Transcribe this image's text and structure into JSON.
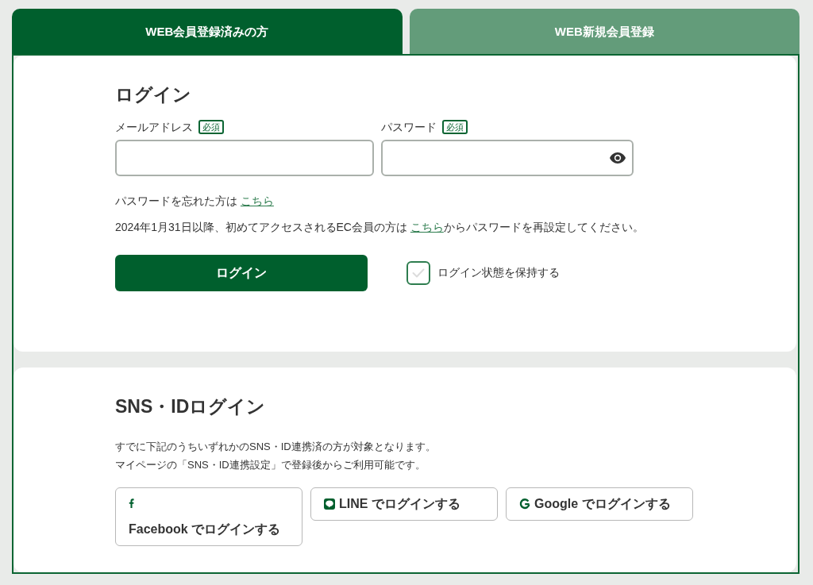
{
  "tabs": [
    {
      "label": "WEB会員登録済みの方",
      "selected": true
    },
    {
      "label": "WEB新規会員登録",
      "selected": false
    }
  ],
  "login": {
    "title": "ログイン",
    "fields": [
      {
        "kind": "email",
        "label": "メールアドレス",
        "badge": "必須"
      },
      {
        "kind": "password",
        "label": "パスワード",
        "badge": "必須"
      }
    ],
    "forgot": {
      "text": "パスワードを忘れた方は",
      "link": "こちら"
    },
    "notice": {
      "before": "2024年1月31日以降、初めてアクセスされるEC会員の方は",
      "link": "こちら",
      "after": "からパスワードを再設定してください。"
    },
    "submit": "ログイン",
    "remember": {
      "label": "ログイン状態を保持する",
      "checked": false
    }
  },
  "sns": {
    "title": "SNS・IDログイン",
    "description": [
      "すでに下記のうちいずれかのSNS・ID連携済の方が対象となります。",
      "マイページの「SNS・ID連携設定」で登録後からご利用可能です。"
    ],
    "buttons": [
      {
        "kind": "facebook",
        "label": "Facebook でログインする"
      },
      {
        "kind": "line",
        "label": "LINE でログインする"
      },
      {
        "kind": "google",
        "label": "Google でログインする"
      }
    ]
  }
}
